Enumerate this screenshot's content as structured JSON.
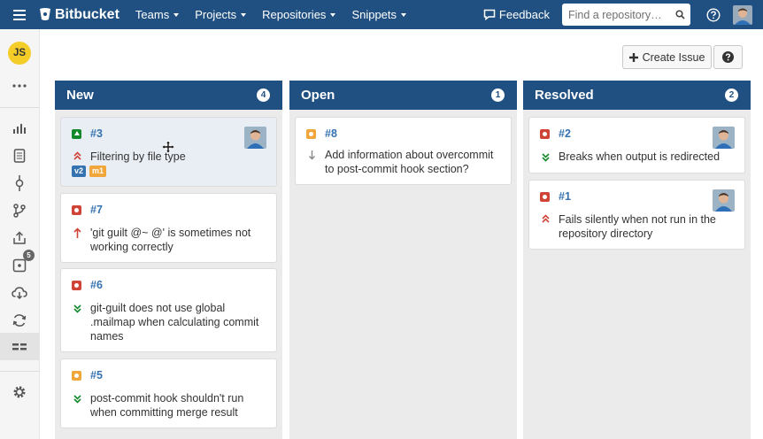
{
  "topbar": {
    "brand": "Bitbucket",
    "nav": [
      {
        "label": "Teams"
      },
      {
        "label": "Projects"
      },
      {
        "label": "Repositories"
      },
      {
        "label": "Snippets"
      }
    ],
    "feedback_label": "Feedback",
    "search_placeholder": "Find a repository…"
  },
  "sidebar": {
    "user_initials": "JS",
    "items": [
      {
        "name": "overview-icon"
      },
      {
        "name": "source-icon"
      },
      {
        "name": "commits-icon"
      },
      {
        "name": "branches-icon"
      },
      {
        "name": "pull-requests-icon"
      },
      {
        "name": "issues-icon",
        "badge": "5"
      },
      {
        "name": "downloads-icon"
      },
      {
        "name": "pipelines-icon"
      },
      {
        "name": "boards-icon"
      },
      {
        "name": "settings-icon"
      }
    ]
  },
  "toolbar": {
    "create_issue_label": "Create Issue"
  },
  "columns": [
    {
      "title": "New",
      "count": "4",
      "cards": [
        {
          "id": "#3",
          "title": "Filtering by file type",
          "type": "improvement",
          "priority": "major",
          "labels": [
            "v2",
            "m1"
          ],
          "avatar": true,
          "highlighted": true
        },
        {
          "id": "#7",
          "title": "'git guilt @~ @' is sometimes not working correctly",
          "type": "bug",
          "priority": "critical",
          "labels": [],
          "avatar": false
        },
        {
          "id": "#6",
          "title": "git-guilt does not use global .mailmap when calculating commit names",
          "type": "bug",
          "priority": "trivial",
          "labels": [],
          "avatar": false
        },
        {
          "id": "#5",
          "title": "post-commit hook shouldn't run when committing merge result",
          "type": "task",
          "priority": "trivial",
          "labels": [],
          "avatar": false
        }
      ]
    },
    {
      "title": "Open",
      "count": "1",
      "cards": [
        {
          "id": "#8",
          "title": "Add information about overcommit to post-commit hook section?",
          "type": "task",
          "priority": "minor",
          "labels": [],
          "avatar": false
        }
      ]
    },
    {
      "title": "Resolved",
      "count": "2",
      "cards": [
        {
          "id": "#2",
          "title": "Breaks when output is redirected",
          "type": "bug",
          "priority": "trivial",
          "labels": [],
          "avatar": true
        },
        {
          "id": "#1",
          "title": "Fails silently when not run in the repository directory",
          "type": "bug",
          "priority": "major",
          "labels": [],
          "avatar": true
        }
      ]
    }
  ],
  "colors": {
    "header": "#205081",
    "link": "#3572b0",
    "bug": "#d04437",
    "task": "#f0a63a",
    "improvement": "#14892c"
  }
}
